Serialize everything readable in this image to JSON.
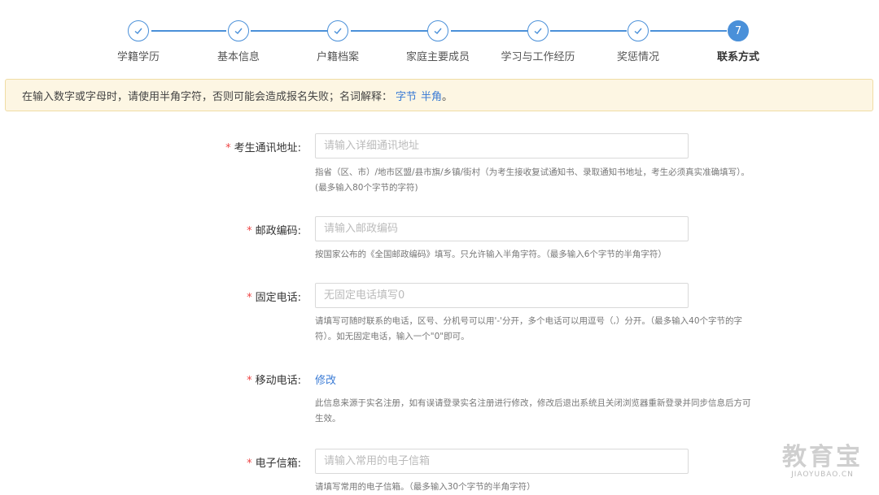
{
  "stepper": {
    "steps": [
      {
        "label": "学籍学历",
        "state": "done"
      },
      {
        "label": "基本信息",
        "state": "done"
      },
      {
        "label": "户籍档案",
        "state": "done"
      },
      {
        "label": "家庭主要成员",
        "state": "done"
      },
      {
        "label": "学习与工作经历",
        "state": "done"
      },
      {
        "label": "奖惩情况",
        "state": "done"
      },
      {
        "label": "联系方式",
        "state": "active",
        "number": "7"
      }
    ],
    "accent_color": "#4a90d9"
  },
  "notice": {
    "text": "在输入数字或字母时，请使用半角字符，否则可能会造成报名失败；名词解释：",
    "link_bytes": "字节",
    "link_halfwidth": "半角",
    "suffix": "。"
  },
  "form": {
    "address": {
      "required_mark": "*",
      "label": "考生通讯地址:",
      "placeholder": "请输入详细通讯地址",
      "hint_line1": "指省（区、市）/地市区盟/县市旗/乡镇/街村（为考生接收复试通知书、录取通知书地址，考生必须真实准确填写）。",
      "hint_line2": "(最多输入80个字节的字符)"
    },
    "postcode": {
      "required_mark": "*",
      "label": "邮政编码:",
      "placeholder": "请输入邮政编码",
      "hint": "按国家公布的《全国邮政编码》填写。只允许输入半角字符。（最多输入6个字节的半角字符）"
    },
    "landline": {
      "required_mark": "*",
      "label": "固定电话:",
      "placeholder": "无固定电话填写0",
      "hint_line1": "请填写可随时联系的电话，区号、分机号可以用'-'分开，多个电话可以用逗号（,）分开。（最多输入40个字节的字",
      "hint_line2": "符）。如无固定电话，输入一个\"0\"即可。"
    },
    "mobile": {
      "required_mark": "*",
      "label": "移动电话:",
      "modify_link": "修改",
      "hint_line1": "此信息来源于实名注册，如有误请登录实名注册进行修改，修改后退出系统且关闭浏览器重新登录并同步信息后方可",
      "hint_line2": "生效。"
    },
    "email": {
      "required_mark": "*",
      "label": "电子信箱:",
      "placeholder": "请输入常用的电子信箱",
      "hint": "请填写常用的电子信箱。（最多输入30个字节的半角字符）"
    }
  },
  "watermark": {
    "big": "教育宝",
    "small": "JIAOYUBAO.CN"
  }
}
